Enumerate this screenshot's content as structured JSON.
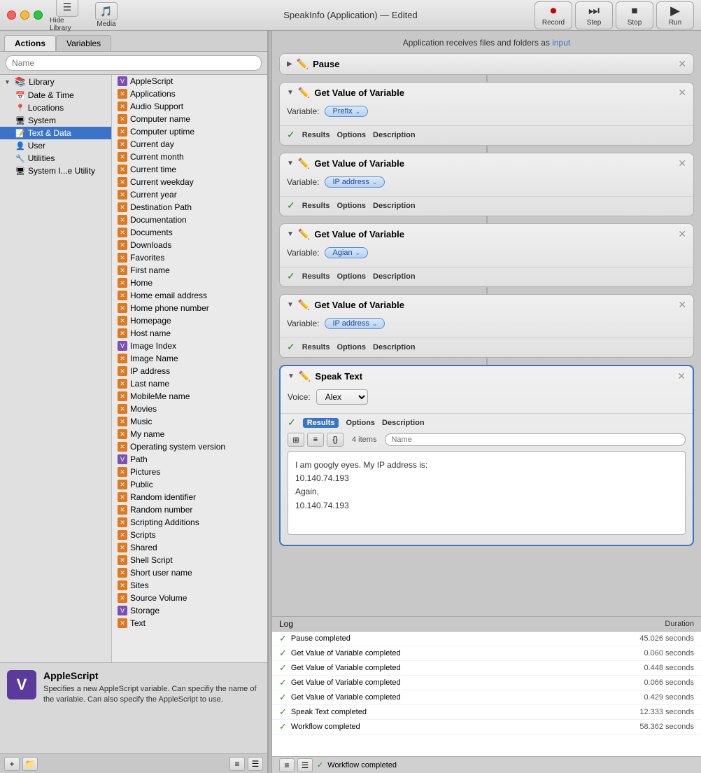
{
  "titleBar": {
    "title": "SpeakInfo (Application) — Edited",
    "buttons": {
      "close": "×",
      "min": "–",
      "max": "+"
    }
  },
  "toolbar": {
    "hideLibrary": "Hide Library",
    "media": "Media",
    "record": "Record",
    "step": "Step",
    "stop": "Stop",
    "run": "Run"
  },
  "leftPanel": {
    "tabs": [
      "Actions",
      "Variables"
    ],
    "searchPlaceholder": "Name",
    "tree": [
      {
        "label": "Library",
        "expanded": true,
        "icon": "📚"
      },
      {
        "label": "Date & Time",
        "icon": "📅",
        "indent": 1
      },
      {
        "label": "Locations",
        "icon": "📍",
        "indent": 1
      },
      {
        "label": "System",
        "icon": "🖥",
        "indent": 1
      },
      {
        "label": "Text & Data",
        "icon": "📝",
        "indent": 1,
        "selected": true
      },
      {
        "label": "User",
        "icon": "👤",
        "indent": 1
      },
      {
        "label": "Utilities",
        "icon": "🔧",
        "indent": 1
      },
      {
        "label": "System I...e Utility",
        "icon": "🖥",
        "indent": 1
      }
    ],
    "list": [
      {
        "label": "AppleScript",
        "type": "purple"
      },
      {
        "label": "Applications",
        "type": "orange"
      },
      {
        "label": "Audio Support",
        "type": "orange"
      },
      {
        "label": "Computer name",
        "type": "orange"
      },
      {
        "label": "Computer uptime",
        "type": "orange"
      },
      {
        "label": "Current day",
        "type": "orange"
      },
      {
        "label": "Current month",
        "type": "orange"
      },
      {
        "label": "Current time",
        "type": "orange"
      },
      {
        "label": "Current weekday",
        "type": "orange"
      },
      {
        "label": "Current year",
        "type": "orange"
      },
      {
        "label": "Destination Path",
        "type": "orange"
      },
      {
        "label": "Documentation",
        "type": "orange"
      },
      {
        "label": "Documents",
        "type": "orange"
      },
      {
        "label": "Downloads",
        "type": "orange"
      },
      {
        "label": "Favorites",
        "type": "orange"
      },
      {
        "label": "First name",
        "type": "orange"
      },
      {
        "label": "Home",
        "type": "orange"
      },
      {
        "label": "Home email address",
        "type": "orange"
      },
      {
        "label": "Home phone number",
        "type": "orange"
      },
      {
        "label": "Homepage",
        "type": "orange"
      },
      {
        "label": "Host name",
        "type": "orange"
      },
      {
        "label": "Image Index",
        "type": "purple"
      },
      {
        "label": "Image Name",
        "type": "orange"
      },
      {
        "label": "IP address",
        "type": "orange"
      },
      {
        "label": "Last name",
        "type": "orange"
      },
      {
        "label": "MobileMe name",
        "type": "orange"
      },
      {
        "label": "Movies",
        "type": "orange"
      },
      {
        "label": "Music",
        "type": "orange"
      },
      {
        "label": "My name",
        "type": "orange"
      },
      {
        "label": "Operating system version",
        "type": "orange"
      },
      {
        "label": "Path",
        "type": "purple"
      },
      {
        "label": "Pictures",
        "type": "orange"
      },
      {
        "label": "Public",
        "type": "orange"
      },
      {
        "label": "Random identifier",
        "type": "orange"
      },
      {
        "label": "Random number",
        "type": "orange"
      },
      {
        "label": "Scripting Additions",
        "type": "orange"
      },
      {
        "label": "Scripts",
        "type": "orange"
      },
      {
        "label": "Shared",
        "type": "orange"
      },
      {
        "label": "Shell Script",
        "type": "orange"
      },
      {
        "label": "Short user name",
        "type": "orange"
      },
      {
        "label": "Sites",
        "type": "orange"
      },
      {
        "label": "Source Volume",
        "type": "orange"
      },
      {
        "label": "Storage",
        "type": "purple"
      },
      {
        "label": "Text",
        "type": "orange"
      }
    ],
    "info": {
      "title": "AppleScript",
      "description": "Specifies a new AppleScript variable. Can specifiy the name of the variable. Can also specify the AppleScript to use."
    }
  },
  "workflow": {
    "header": "Application receives files and folders as input",
    "headerLink": "input",
    "blocks": [
      {
        "id": "pause",
        "title": "Pause",
        "collapsed": true,
        "icon": "✏️"
      },
      {
        "id": "get-var-1",
        "title": "Get Value of Variable",
        "icon": "✏️",
        "variable": "Prefix",
        "footerItems": [
          "Results",
          "Options",
          "Description"
        ]
      },
      {
        "id": "get-var-2",
        "title": "Get Value of Variable",
        "icon": "✏️",
        "variable": "IP address",
        "footerItems": [
          "Results",
          "Options",
          "Description"
        ]
      },
      {
        "id": "get-var-3",
        "title": "Get Value of Variable",
        "icon": "✏️",
        "variable": "Agian",
        "footerItems": [
          "Results",
          "Options",
          "Description"
        ]
      },
      {
        "id": "get-var-4",
        "title": "Get Value of Variable",
        "icon": "✏️",
        "variable": "IP address",
        "footerItems": [
          "Results",
          "Options",
          "Description"
        ]
      },
      {
        "id": "speak-text",
        "title": "Speak Text",
        "icon": "✏️",
        "voice": "Alex",
        "footerItems": [
          "Results",
          "Options",
          "Description"
        ],
        "itemCount": "4 items",
        "searchPlaceholder": "Name",
        "content": [
          "I am googly eyes. My IP address is:",
          "10.140.74.193",
          "Again,",
          "10.140.74.193"
        ]
      }
    ]
  },
  "log": {
    "title": "Log",
    "durationHeader": "Duration",
    "entries": [
      {
        "text": "Pause completed",
        "duration": "45.026 seconds"
      },
      {
        "text": "Get Value of Variable completed",
        "duration": "0.060 seconds"
      },
      {
        "text": "Get Value of Variable completed",
        "duration": "0.448 seconds"
      },
      {
        "text": "Get Value of Variable completed",
        "duration": "0.066 seconds"
      },
      {
        "text": "Get Value of Variable completed",
        "duration": "0.429 seconds"
      },
      {
        "text": "Speak Text completed",
        "duration": "12.333 seconds"
      },
      {
        "text": "Workflow completed",
        "duration": "58.362 seconds"
      }
    ],
    "statusText": "Workflow completed"
  }
}
